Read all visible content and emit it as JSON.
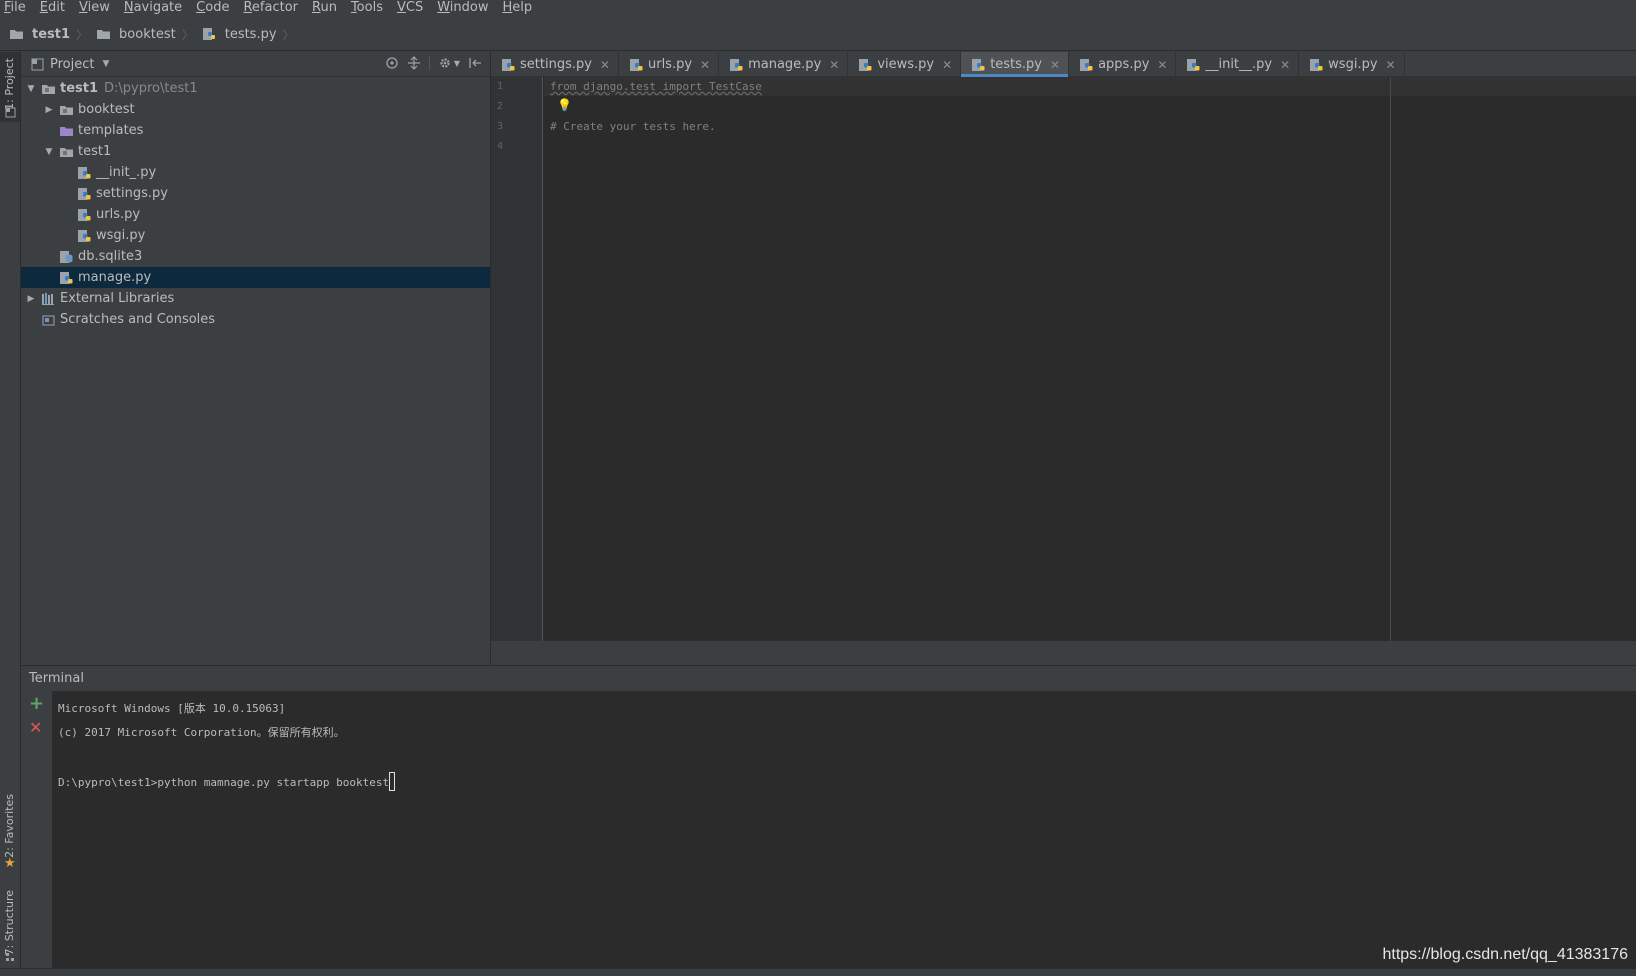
{
  "menubar": {
    "items": [
      {
        "mn": "F",
        "rest": "ile"
      },
      {
        "mn": "E",
        "rest": "dit"
      },
      {
        "mn": "V",
        "rest": "iew"
      },
      {
        "mn": "N",
        "rest": "avigate"
      },
      {
        "mn": "C",
        "rest": "ode"
      },
      {
        "mn": "R",
        "rest": "efactor"
      },
      {
        "mn": "R",
        "rest": "un"
      },
      {
        "mn": "T",
        "rest": "ools"
      },
      {
        "mn": "V",
        "rest": "CS"
      },
      {
        "mn": "W",
        "rest": "indow"
      },
      {
        "mn": "H",
        "rest": "elp"
      }
    ]
  },
  "breadcrumb": {
    "root": "test1",
    "folder": "booktest",
    "file": "tests.py"
  },
  "left_stripe": {
    "project": "1: Project",
    "favorites": "2: Favorites",
    "structure": "7: Structure"
  },
  "project_panel": {
    "title": "Project",
    "tree": [
      {
        "label": "test1",
        "hint": "D:\\pypro\\test1",
        "depth": 0,
        "arrow": "down",
        "icon": "folder",
        "bold": true
      },
      {
        "label": "booktest",
        "depth": 1,
        "arrow": "right",
        "icon": "folder"
      },
      {
        "label": "templates",
        "depth": 1,
        "arrow": "none",
        "icon": "folder-purple"
      },
      {
        "label": "test1",
        "depth": 1,
        "arrow": "down",
        "icon": "folder"
      },
      {
        "label": "__init_.py",
        "depth": 2,
        "arrow": "none",
        "icon": "python"
      },
      {
        "label": "settings.py",
        "depth": 2,
        "arrow": "none",
        "icon": "python"
      },
      {
        "label": "urls.py",
        "depth": 2,
        "arrow": "none",
        "icon": "python"
      },
      {
        "label": "wsgi.py",
        "depth": 2,
        "arrow": "none",
        "icon": "python"
      },
      {
        "label": "db.sqlite3",
        "depth": 1,
        "arrow": "none",
        "icon": "db"
      },
      {
        "label": "manage.py",
        "depth": 1,
        "arrow": "none",
        "icon": "python",
        "selected": true
      },
      {
        "label": "External Libraries",
        "depth": 0,
        "arrow": "right",
        "icon": "library"
      },
      {
        "label": "Scratches and Consoles",
        "depth": 0,
        "arrow": "none",
        "icon": "scratch"
      }
    ]
  },
  "tabs": [
    {
      "label": "settings.py",
      "active": false
    },
    {
      "label": "urls.py",
      "active": false
    },
    {
      "label": "manage.py",
      "active": false
    },
    {
      "label": "views.py",
      "active": false
    },
    {
      "label": "tests.py",
      "active": true
    },
    {
      "label": "apps.py",
      "active": false
    },
    {
      "label": "__init__.py",
      "active": false
    },
    {
      "label": "wsgi.py",
      "active": false
    }
  ],
  "editor": {
    "lines": [
      {
        "no": "1",
        "text": "from django.test import TestCase",
        "unused": true
      },
      {
        "no": "2",
        "text": "",
        "bulb": true
      },
      {
        "no": "3",
        "text": "# Create your tests here."
      },
      {
        "no": "4",
        "text": ""
      }
    ]
  },
  "terminal": {
    "title": "Terminal",
    "lines": [
      "Microsoft Windows [版本 10.0.15063]",
      "(c) 2017 Microsoft Corporation。保留所有权利。",
      "",
      "D:\\pypro\\test1>python mamnage.py startapp booktest"
    ]
  },
  "watermark": "https://blog.csdn.net/qq_41383176",
  "colors": {
    "accent": "#4a88c7",
    "selection": "#0d293e",
    "python_blue": "#3d7bbf",
    "python_yellow": "#f4c542",
    "add_green": "#59a869",
    "close_red": "#e05555"
  }
}
